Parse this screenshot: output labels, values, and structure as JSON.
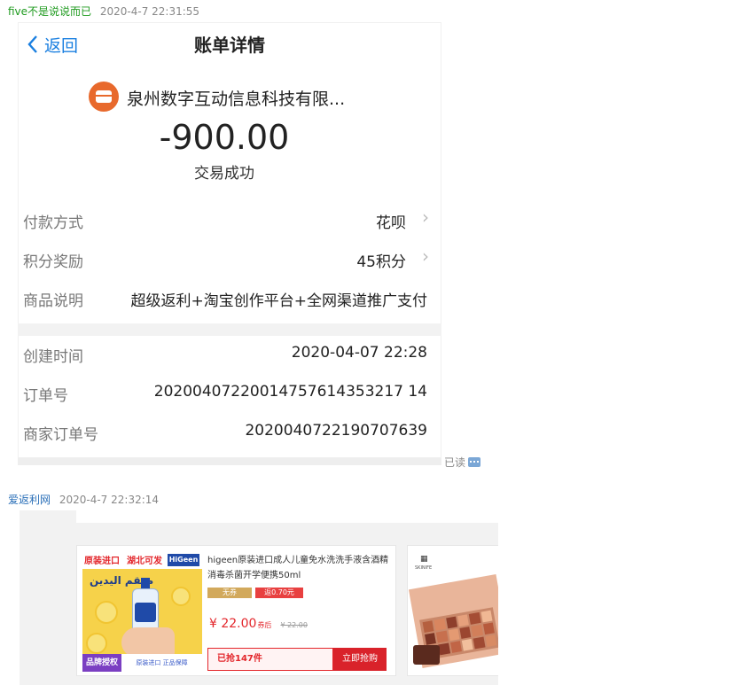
{
  "message1": {
    "sender": "five不是说说而已",
    "timestamp": "2020-4-7 22:31:55",
    "read_status": "已读",
    "bill": {
      "back_label": "返回",
      "title": "账单详情",
      "merchant": "泉州数字互动信息科技有限...",
      "amount": "-900.00",
      "status": "交易成功",
      "rows": [
        {
          "label": "付款方式",
          "value": "花呗"
        },
        {
          "label": "积分奖励",
          "value": "45积分"
        },
        {
          "label": "商品说明",
          "value": "超级返利+淘宝创作平台+全网渠道推广支付"
        },
        {
          "label": "创建时间",
          "value": "2020-04-07 22:28"
        },
        {
          "label": "订单号",
          "value": "20200407220014757614353217 14"
        },
        {
          "label": "商家订单号",
          "value": "2020040722190707639"
        }
      ]
    }
  },
  "message2": {
    "sender": "爱返利网",
    "timestamp": "2020-4-7 22:32:14",
    "product": {
      "banner_top_left": "原装进口",
      "banner_top_mid": "湖北可发",
      "brand_logo": "HiGeen",
      "arabic_text": "معقم اليدين",
      "badge_brand": "品牌授权",
      "badge_tags": "原装进口  正品保障",
      "title": "higeen原装进口成人儿童免水洗洗手液含酒精消毒杀菌开学便携50ml",
      "tag_free": "无券",
      "tag_discount": "返0.70元",
      "price": "¥ 22.00",
      "price_suffix": "券后",
      "old_price": "¥ 22.00",
      "sold": "已抢147件",
      "buy_label": "立即抢购"
    },
    "product2": {
      "brand": "SKINIFE"
    }
  }
}
